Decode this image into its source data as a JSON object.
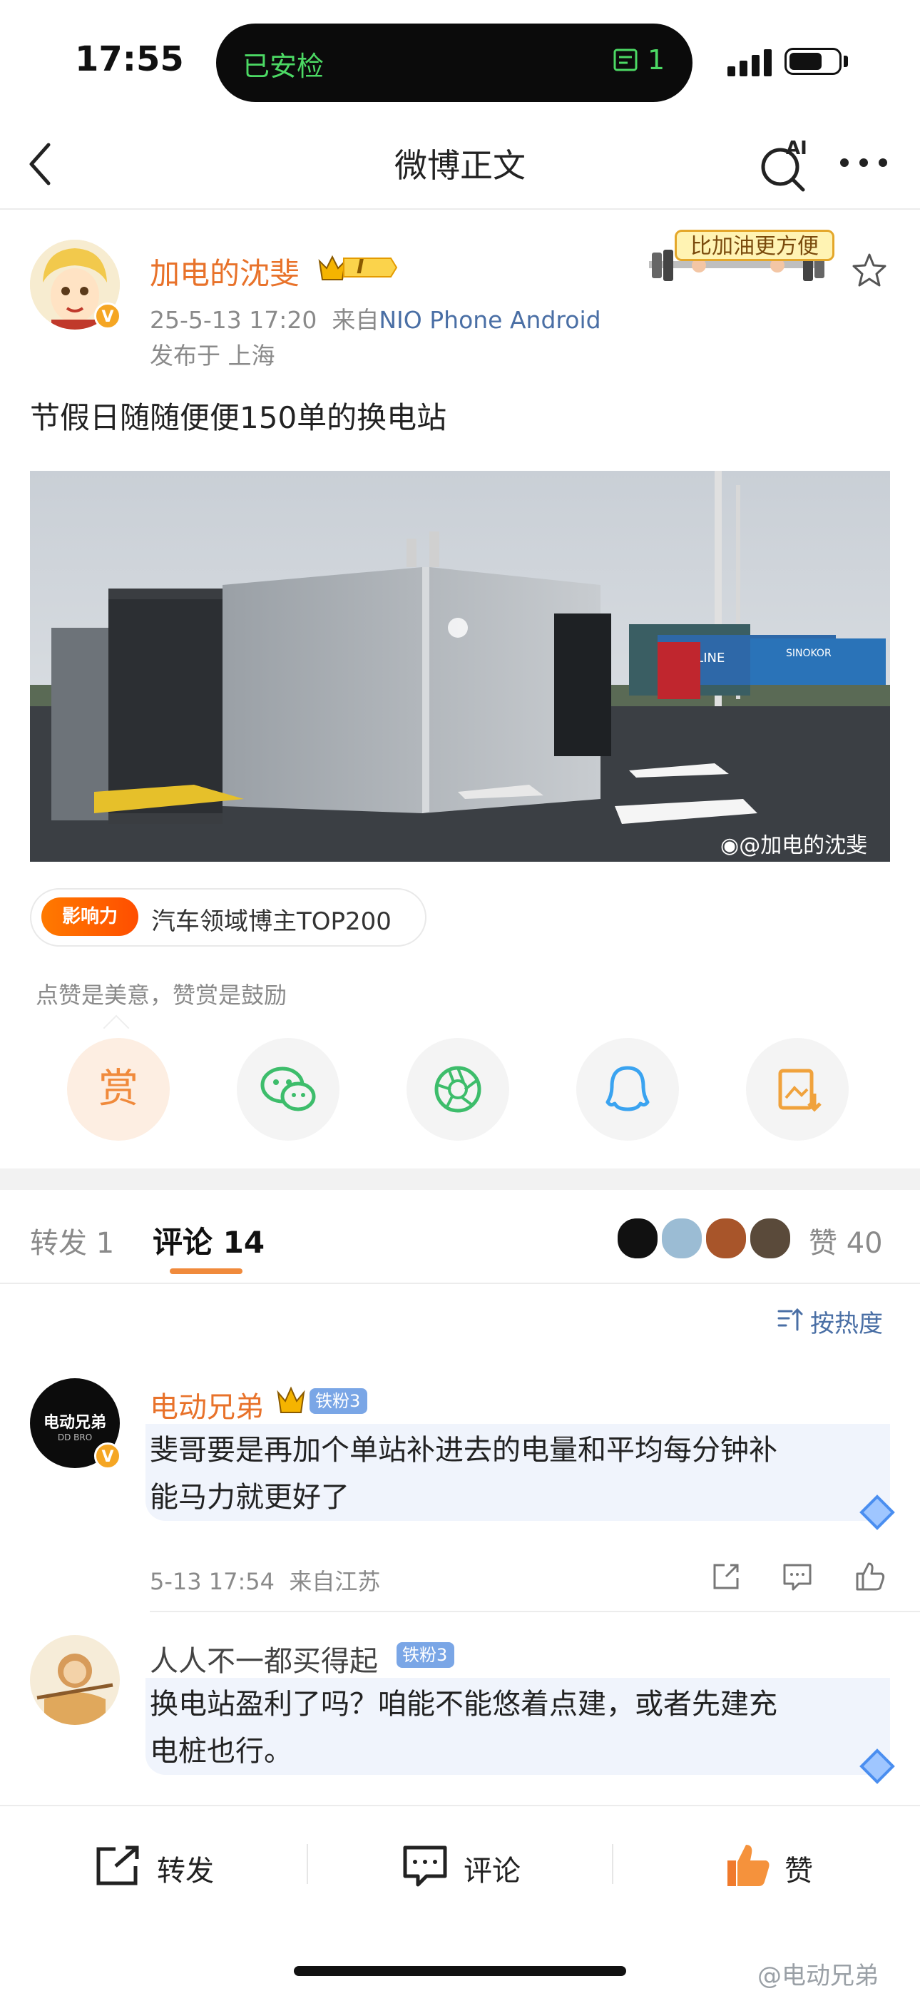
{
  "status": {
    "time": "17:55",
    "island_left": "已安检",
    "island_right": "1"
  },
  "nav": {
    "title": "微博正文",
    "ai_label": "AI"
  },
  "post": {
    "author": "加电的沈斐",
    "level_badge": "I",
    "date": "25-5-13 17:20",
    "source_prefix": "来自",
    "source": "NIO Phone Android",
    "location": "发布于 上海",
    "promo": "比加油更方便",
    "text": "节假日随随便便150单的换电站",
    "image_watermark": "@加电的沈斐",
    "image_sign": "BS LINE",
    "image_sign2": "SINOKOR",
    "influence_badge": "影响力",
    "influence_text": "汽车领域博主TOP200"
  },
  "reward": {
    "hint": "点赞是美意，赞赏是鼓励",
    "reward_label": "赏"
  },
  "tabs": {
    "repost": "转发 1",
    "comments": "评论 14",
    "likes": "赞 40"
  },
  "sort": {
    "label": "按热度"
  },
  "comments": [
    {
      "name": "电动兄弟",
      "badge": "铁粉3",
      "text_line1": "斐哥要是再加个单站补进去的电量和平均每分钟补",
      "text_line2": "能马力就更好了",
      "time": "5-13 17:54",
      "location": "来自江苏",
      "avatar_text": "电动兄弟",
      "avatar_sub": "DD BRO"
    },
    {
      "name": "人人不一都买得起",
      "badge": "铁粉3",
      "text_line1": "换电站盈利了吗？咱能不能悠着点建，或者先建充",
      "text_line2": "电桩也行。"
    }
  ],
  "bottom": {
    "repost": "转发",
    "comment": "评论",
    "like": "赞"
  },
  "footer": {
    "watermark": "@电动兄弟"
  },
  "colors": {
    "accent": "#f08a3c",
    "name": "#e8722a",
    "link": "#4a6fa5",
    "island_text": "#4cd964"
  }
}
